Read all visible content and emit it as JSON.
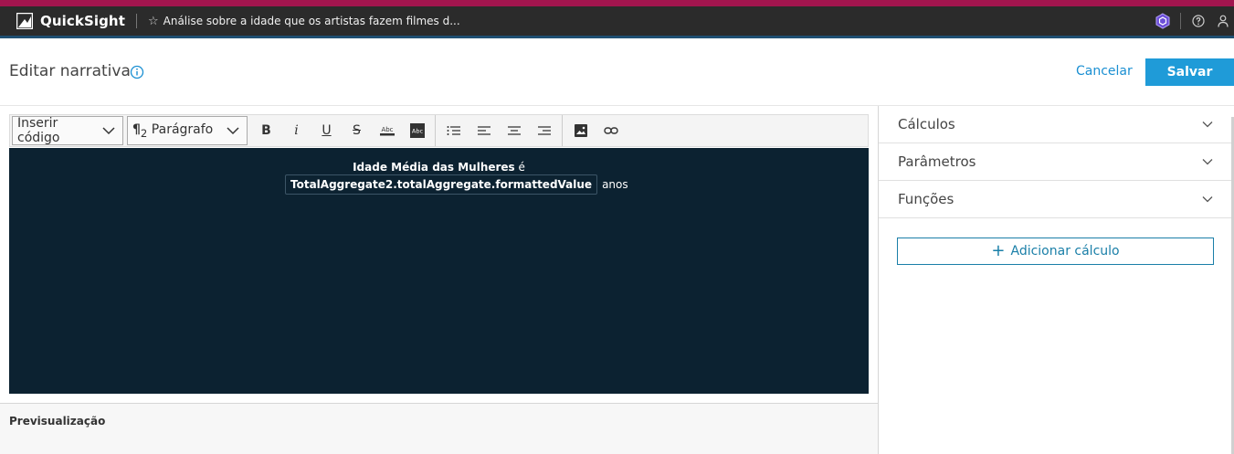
{
  "topbar": {
    "app_name": "QuickSight",
    "analysis_title": "Análise sobre a idade que os artistas fazem filmes d...",
    "star_glyph": "☆",
    "icons": [
      "quicksight-logo-icon",
      "star-icon",
      "hexagon-extension-icon",
      "help-icon",
      "user-icon"
    ]
  },
  "header": {
    "title": "Editar narrativa",
    "cancel_label": "Cancelar",
    "save_label": "Salvar",
    "accent_color": "#1f9bd8"
  },
  "toolbar": {
    "insert_code_label": "Inserir código",
    "paragraph_label": "Parágrafo",
    "paragraph_prefix": "¶",
    "paragraph_subscript": "2",
    "bold_label": "B",
    "italic_label": "i",
    "underline_label": "U",
    "strike_label": "S"
  },
  "editor": {
    "title_bold": "Idade Média das Mulheres",
    "title_tail": " é",
    "code_chip": "TotalAggregate2.totalAggregate.formattedValue",
    "suffix": "anos",
    "background": "#0c2231"
  },
  "preview": {
    "label": "Previsualização"
  },
  "panel": {
    "sections": [
      {
        "label": "Cálculos"
      },
      {
        "label": "Parâmetros"
      },
      {
        "label": "Funções"
      }
    ],
    "add_calc_label": "Adicionar cálculo"
  }
}
